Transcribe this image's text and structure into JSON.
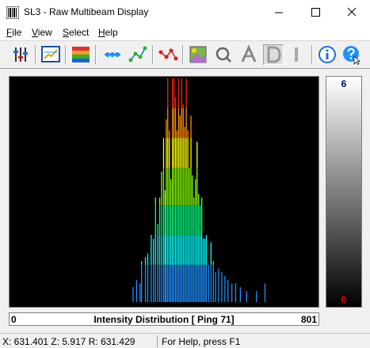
{
  "window": {
    "title": "SL3 - Raw Multibeam Display"
  },
  "menu": {
    "items": [
      {
        "mnemonic": "F",
        "rest": "ile"
      },
      {
        "mnemonic": "V",
        "rest": "iew"
      },
      {
        "mnemonic": "S",
        "rest": "elect"
      },
      {
        "mnemonic": "H",
        "rest": "elp"
      }
    ]
  },
  "toolbar": {
    "buttons": [
      "sliders-icon",
      "chart-icon",
      "palette-icon",
      "beam-icon",
      "network-icon",
      "points-icon",
      "image-icon",
      "zoom-q-icon",
      "a-icon",
      "d-icon",
      "bar-icon",
      "info-icon",
      "help-icon"
    ],
    "pressed": "d-icon"
  },
  "colorscale": {
    "max_label": "6",
    "min_label": "0",
    "max_color": "#000080",
    "min_color": "#ff0000"
  },
  "chart_data": {
    "type": "bar",
    "title": "Intensity Distribution [ Ping 71]",
    "xlim": [
      0,
      801
    ],
    "x_min_label": "0",
    "x_max_label": "801",
    "ylim": [
      0,
      6
    ],
    "color_scale": [
      "#1e90ff",
      "#00ffff",
      "#00ff7f",
      "#7fff00",
      "#ffff00",
      "#ff8c00",
      "#ff2200"
    ],
    "x": [
      319,
      328,
      337,
      341,
      351,
      357,
      366,
      372,
      377,
      383,
      388,
      393,
      398,
      402,
      405,
      409,
      413,
      417,
      421,
      425,
      429,
      433,
      437,
      441,
      445,
      449,
      453,
      457,
      461,
      465,
      469,
      473,
      477,
      481,
      485,
      489,
      493,
      497,
      501,
      505,
      509,
      515,
      521,
      527,
      533,
      541,
      549,
      557,
      565,
      575,
      585,
      597,
      613,
      639,
      661
    ],
    "values": [
      0.4,
      0.6,
      0.5,
      1.1,
      1.2,
      1.3,
      1.8,
      1.7,
      2.8,
      2.1,
      2.8,
      3.5,
      4.4,
      3.0,
      4.9,
      6.0,
      4.6,
      3.3,
      6.0,
      6.0,
      5.5,
      4.6,
      6.0,
      5.0,
      6.0,
      5.3,
      4.7,
      6.0,
      4.6,
      3.6,
      5.0,
      3.4,
      2.8,
      3.3,
      4.3,
      2.9,
      2.6,
      2.8,
      1.7,
      1.7,
      1.8,
      1.0,
      1.6,
      1.1,
      0.8,
      0.9,
      0.8,
      0.7,
      0.6,
      0.5,
      0.5,
      0.4,
      0.3,
      0.3,
      0.5
    ]
  },
  "status": {
    "coords": "X: 631.401  Z: 5.917  R: 631.429",
    "help": "For Help, press F1"
  }
}
